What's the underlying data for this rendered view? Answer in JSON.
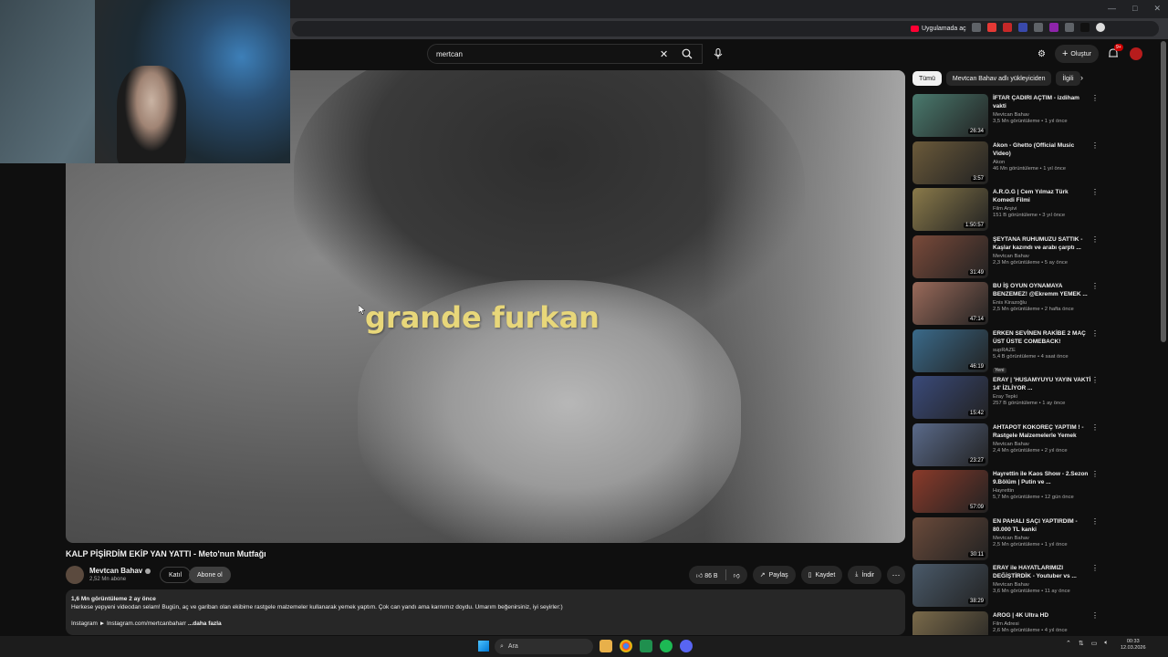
{
  "browser": {
    "app_pill": "Uygulamada aç"
  },
  "header": {
    "search_value": "mertcan",
    "create_label": "Oluştur",
    "notification_count": "9+"
  },
  "video": {
    "caption": "grande furkan",
    "title": "KALP PİŞİRDİM EKİP YAN YATTI - Meto'nun Mutfağı",
    "channel_name": "Mevtcan Bahav",
    "subscribers": "2,52 Mn abone",
    "join_label": "Katıl",
    "subscribe_label": "Abone ol",
    "likes": "86 B",
    "share_label": "Paylaş",
    "save_label": "Kaydet",
    "download_label": "İndir"
  },
  "description": {
    "meta": "1,6 Mn görüntüleme  2 ay önce",
    "text": "Herkese yepyeni videodan selam! Bugün, aç ve gariban olan ekibime rastgele malzemeler kullanarak yemek yaptım. Çok can yandı ama karnımız doydu. Umarım beğenirsiniz, iyi seyirler:)",
    "link_line": "Instagram ► Instagram.com/mertcanbaharr ",
    "more": "...daha fazla"
  },
  "chips": [
    "Tümü",
    "Mevtcan Bahav adlı yükleyiciden",
    "İlgili"
  ],
  "related": [
    {
      "title": "İFTAR ÇADIRI AÇTIM - izdiham vakti",
      "channel": "Mevtcan Bahav",
      "meta": "3,5 Mn görüntüleme • 1 yıl önce",
      "duration": "26:34",
      "color": "#4a7a6e",
      "badge": ""
    },
    {
      "title": "Akon - Ghetto (Official Music Video)",
      "channel": "Akon",
      "meta": "46 Mn görüntüleme • 1 yıl önce",
      "duration": "3:57",
      "color": "#6b5a3a",
      "badge": ""
    },
    {
      "title": "A.R.O.G | Cem Yılmaz Türk Komedi Filmi",
      "channel": "Film Arşivi",
      "meta": "151 B görüntüleme • 3 yıl önce",
      "duration": "1:50:57",
      "color": "#8a7a4a",
      "badge": ""
    },
    {
      "title": "ŞEYTANA RUHUMUZU SATTIK - Kaşlar kazındı ve arabı çarptı ...",
      "channel": "Mevtcan Bahav",
      "meta": "2,3 Mn görüntüleme • 5 ay önce",
      "duration": "31:49",
      "color": "#7a4a3a",
      "badge": ""
    },
    {
      "title": "BU İŞ OYUN OYNAMAYA BENZEMEZ! @Ekremm YEMEK ...",
      "channel": "Enis Kirazoğlu",
      "meta": "2,5 Mn görüntüleme • 2 hafta önce",
      "duration": "47:14",
      "color": "#9a6a5a",
      "badge": ""
    },
    {
      "title": "ERKEN SEVİNEN RAKİBE 2 MAÇ ÜST ÜSTE COMEBACK!",
      "channel": "supRAZE",
      "meta": "5,4 B görüntüleme • 4 saat önce",
      "duration": "46:19",
      "color": "#3a6a8a",
      "badge": "Yeni"
    },
    {
      "title": "ERAY | 'HUSAMYUYU YAYIN VAKTİ 14' İZLİYOR ...",
      "channel": "Eray Tepki",
      "meta": "257 B görüntüleme • 1 ay önce",
      "duration": "15:42",
      "color": "#3a4a7a",
      "badge": ""
    },
    {
      "title": "AHTAPOT KOKOREÇ YAPTIM ! - Rastgele Malzemelerle Yemek",
      "channel": "Mevtcan Bahav",
      "meta": "2,4 Mn görüntüleme • 2 yıl önce",
      "duration": "23:27",
      "color": "#5a6a8a",
      "badge": ""
    },
    {
      "title": "Hayrettin ile Kaos Show - 2.Sezon 9.Bölüm | Putin ve ...",
      "channel": "Hayrettin",
      "meta": "5,7 Mn görüntüleme • 12 gün önce",
      "duration": "57:09",
      "color": "#8a3a2a",
      "badge": ""
    },
    {
      "title": "EN PAHALI SAÇI YAPTIRDIM - 80.000 TL kanki",
      "channel": "Mevtcan Bahav",
      "meta": "2,5 Mn görüntüleme • 1 yıl önce",
      "duration": "30:11",
      "color": "#6a4a3a",
      "badge": ""
    },
    {
      "title": "ERAY ile HAYATLARIMIZI DEĞİŞTİRDİK - Youtuber vs ...",
      "channel": "Mevtcan Bahav",
      "meta": "3,6 Mn görüntüleme • 11 ay önce",
      "duration": "38:29",
      "color": "#4a5a6a",
      "badge": ""
    },
    {
      "title": "AROG | 4K Ultra HD",
      "channel": "Film Adresi",
      "meta": "2,6 Mn görüntüleme • 4 yıl önce",
      "duration": "",
      "color": "#7a6a4a",
      "badge": ""
    }
  ],
  "taskbar": {
    "search_placeholder": "Ara",
    "time": "00:33",
    "date": "12.03.2026"
  }
}
